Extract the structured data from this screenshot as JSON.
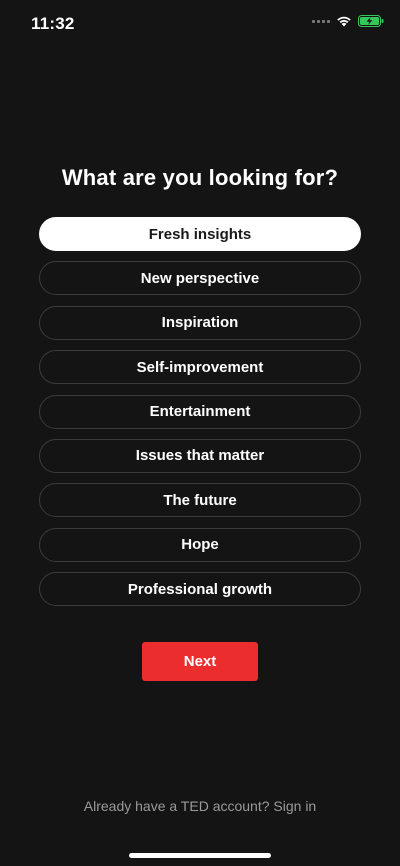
{
  "status_bar": {
    "time": "11:32",
    "icons": [
      "cellular-signal-icon",
      "wifi-icon",
      "battery-charging-icon"
    ],
    "battery_color": "#34c759"
  },
  "heading": "What are you looking for?",
  "options": [
    {
      "label": "Fresh insights",
      "selected": true
    },
    {
      "label": "New perspective",
      "selected": false
    },
    {
      "label": "Inspiration",
      "selected": false
    },
    {
      "label": "Self-improvement",
      "selected": false
    },
    {
      "label": "Entertainment",
      "selected": false
    },
    {
      "label": "Issues that matter",
      "selected": false
    },
    {
      "label": "The future",
      "selected": false
    },
    {
      "label": "Hope",
      "selected": false
    },
    {
      "label": "Professional growth",
      "selected": false
    }
  ],
  "next_button": {
    "label": "Next",
    "color": "#eb2d2d"
  },
  "signin_text": "Already have a TED account? Sign in"
}
